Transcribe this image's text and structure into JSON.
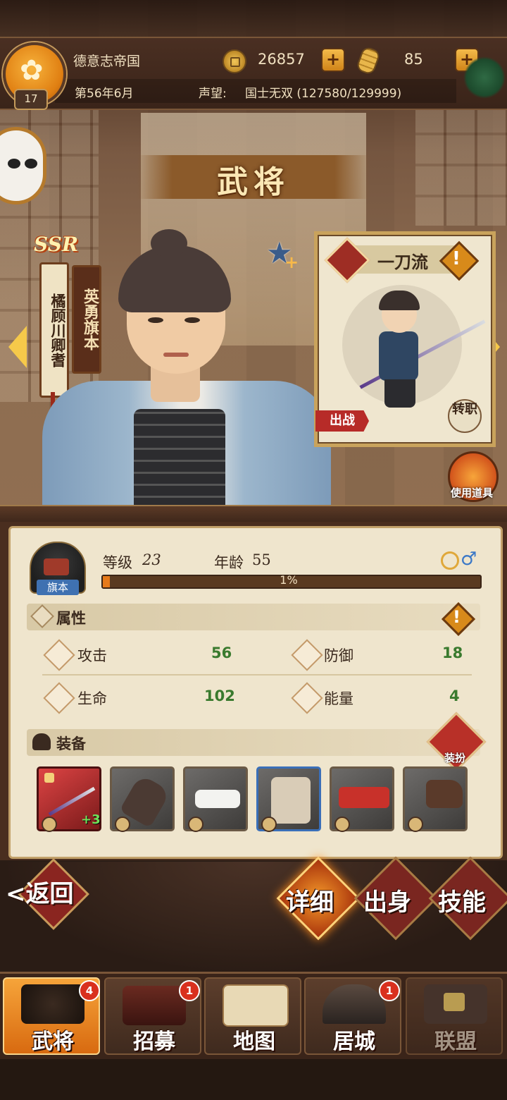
{
  "header": {
    "player_level": "17",
    "country": "德意志帝国",
    "date": "第56年6月",
    "gold": "26857",
    "food": "85",
    "reputation_label": "声望:",
    "reputation_value": "国士无双 (127580/129999)"
  },
  "page_title": "武将",
  "general": {
    "rarity": "SSR",
    "name": "橘顾川卿耆",
    "title": "英勇旗本",
    "rank": "旗本",
    "level_label": "等级",
    "level": "23",
    "age_label": "年龄",
    "age": "55",
    "exp_percent": "1%",
    "exp_fraction": 0.01
  },
  "class_card": {
    "name": "一刀流",
    "sortie_label": "出战",
    "transfer_label": "转职"
  },
  "use_item_label": "使用道具",
  "attributes": {
    "section_title": "属性",
    "attack_label": "攻击",
    "attack_value": "56",
    "defense_label": "防御",
    "defense_value": "18",
    "hp_label": "生命",
    "hp_value": "102",
    "energy_label": "能量",
    "energy_value": "4"
  },
  "equipment": {
    "section_title": "装备",
    "dress_label": "装扮",
    "weapon_bonus": "+3",
    "slots": [
      "katana",
      "gauntlet",
      "headband",
      "robe",
      "belt",
      "boots"
    ]
  },
  "actions": {
    "back_label": "返回",
    "back_prefix": "<",
    "detail_label": "详细",
    "origin_label": "出身",
    "skill_label": "技能"
  },
  "nav": {
    "generals": {
      "label": "武将",
      "badge": "4"
    },
    "recruit": {
      "label": "招募",
      "badge": "1"
    },
    "map": {
      "label": "地图"
    },
    "castle": {
      "label": "居城",
      "badge": "1"
    },
    "alliance": {
      "label": "联盟"
    }
  },
  "colors": {
    "accent": "#e67a1a",
    "stat_value": "#3a7a2e",
    "badge": "#d9301e"
  }
}
